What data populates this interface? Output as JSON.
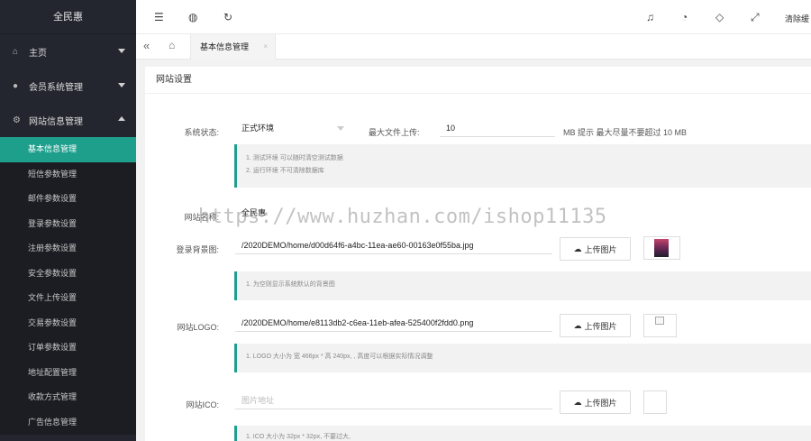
{
  "sidebar": {
    "brand": "全民惠",
    "main_items": [
      {
        "label": "主页",
        "icon": "home-icon"
      },
      {
        "label": "会员系统管理",
        "icon": "users-icon"
      },
      {
        "label": "网站信息管理",
        "icon": "gear-icon"
      }
    ],
    "sub_items": [
      {
        "label": "基本信息管理",
        "active": true
      },
      {
        "label": "短信参数管理"
      },
      {
        "label": "邮件参数设置"
      },
      {
        "label": "登录参数设置"
      },
      {
        "label": "注册参数设置"
      },
      {
        "label": "安全参数设置"
      },
      {
        "label": "文件上传设置"
      },
      {
        "label": "交易参数设置"
      },
      {
        "label": "订单参数设置"
      },
      {
        "label": "地址配置管理"
      },
      {
        "label": "收款方式管理"
      },
      {
        "label": "广告信息管理"
      }
    ]
  },
  "topbar": {
    "icons": [
      "menu-fold-icon",
      "globe-icon",
      "refresh-icon",
      "bell-icon",
      "theme-icon",
      "tag-icon",
      "fullscreen-icon"
    ],
    "clear_label": "清除缓"
  },
  "tabs": {
    "active_label": "基本信息管理"
  },
  "content": {
    "card_title": "网站设置",
    "status_label": "系统状态:",
    "status_value": "正式环境",
    "max_upload_label": "最大文件上传:",
    "max_upload_value": "10",
    "max_upload_hint": "MB 提示 最大尽量不要超过 10 MB",
    "status_hints": [
      "1. 测试环境 可以随时清空测试数据",
      "2. 运行环境 不可清除数据库"
    ],
    "site_name_label": "网站名称:",
    "site_name_value": "全民惠",
    "login_bg_label": "登录背景图:",
    "login_bg_value": "/2020DEMO/home/d00d64f6-a4bc-11ea-ae60-00163e0f55ba.jpg",
    "login_bg_hint": "1. 为空则显示系统默认的背景图",
    "logo_label": "网站LOGO:",
    "logo_value": "/2020DEMO/home/e8113db2-c6ea-11eb-afea-525400f2fdd0.png",
    "logo_hint": "1. LOGO 大小为 宽 466px * 高 240px, , 高度可以根据实际情况调整",
    "ico_label": "网站ICO:",
    "ico_placeholder": "图片地址",
    "ico_hint": "1. ICO 大小为 32px * 32px, 不要过大,",
    "upload_label": "上传图片"
  },
  "watermark": "https://www.huzhan.com/ishop11135",
  "colors": {
    "sidebar_bg": "#23262e",
    "accent": "#1e9f8c"
  }
}
